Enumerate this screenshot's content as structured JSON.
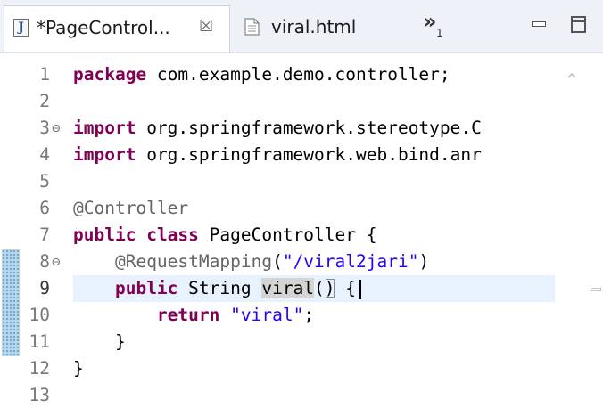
{
  "tabs": {
    "active": {
      "label": "*PageControl...",
      "icon": "java-file-icon",
      "close_glyph": "☒"
    },
    "inactive": {
      "label": "viral.html",
      "icon": "html-file-icon"
    },
    "overflow": {
      "glyph": "»",
      "count": "1"
    }
  },
  "colors": {
    "keyword": "#7f0055",
    "annotation": "#646464",
    "string": "#2a00ff",
    "line_number": "#787878",
    "current_line": "#e8f2fe",
    "change_ruler": "#bcd7ea"
  },
  "editor": {
    "current_line_number": "9",
    "lines": [
      {
        "n": "1",
        "fold": "",
        "code": [
          "package",
          " com.example.demo.controller;"
        ]
      },
      {
        "n": "2",
        "fold": "",
        "code": []
      },
      {
        "n": "3",
        "fold": "⊖",
        "code": [
          "import",
          " org.springframework.stereotype.C"
        ]
      },
      {
        "n": "4",
        "fold": "",
        "code": [
          "import",
          " org.springframework.web.bind.anr"
        ]
      },
      {
        "n": "5",
        "fold": "",
        "code": []
      },
      {
        "n": "6",
        "fold": "",
        "code": [
          "@Controller"
        ]
      },
      {
        "n": "7",
        "fold": "",
        "code": [
          "public",
          " ",
          "class",
          " PageController {"
        ]
      },
      {
        "n": "8",
        "fold": "⊖",
        "code": [
          "    ",
          "@RequestMapping",
          "(",
          "\"/viral2jari\"",
          ")"
        ]
      },
      {
        "n": "9",
        "fold": "",
        "code": [
          "    ",
          "public",
          " String ",
          "viral",
          "(",
          ")",
          " {"
        ]
      },
      {
        "n": "10",
        "fold": "",
        "code": [
          "        ",
          "return",
          " ",
          "\"viral\"",
          ";"
        ]
      },
      {
        "n": "11",
        "fold": "",
        "code": [
          "    }"
        ]
      },
      {
        "n": "12",
        "fold": "",
        "code": [
          "}"
        ]
      },
      {
        "n": "13",
        "fold": "",
        "code": []
      }
    ]
  }
}
